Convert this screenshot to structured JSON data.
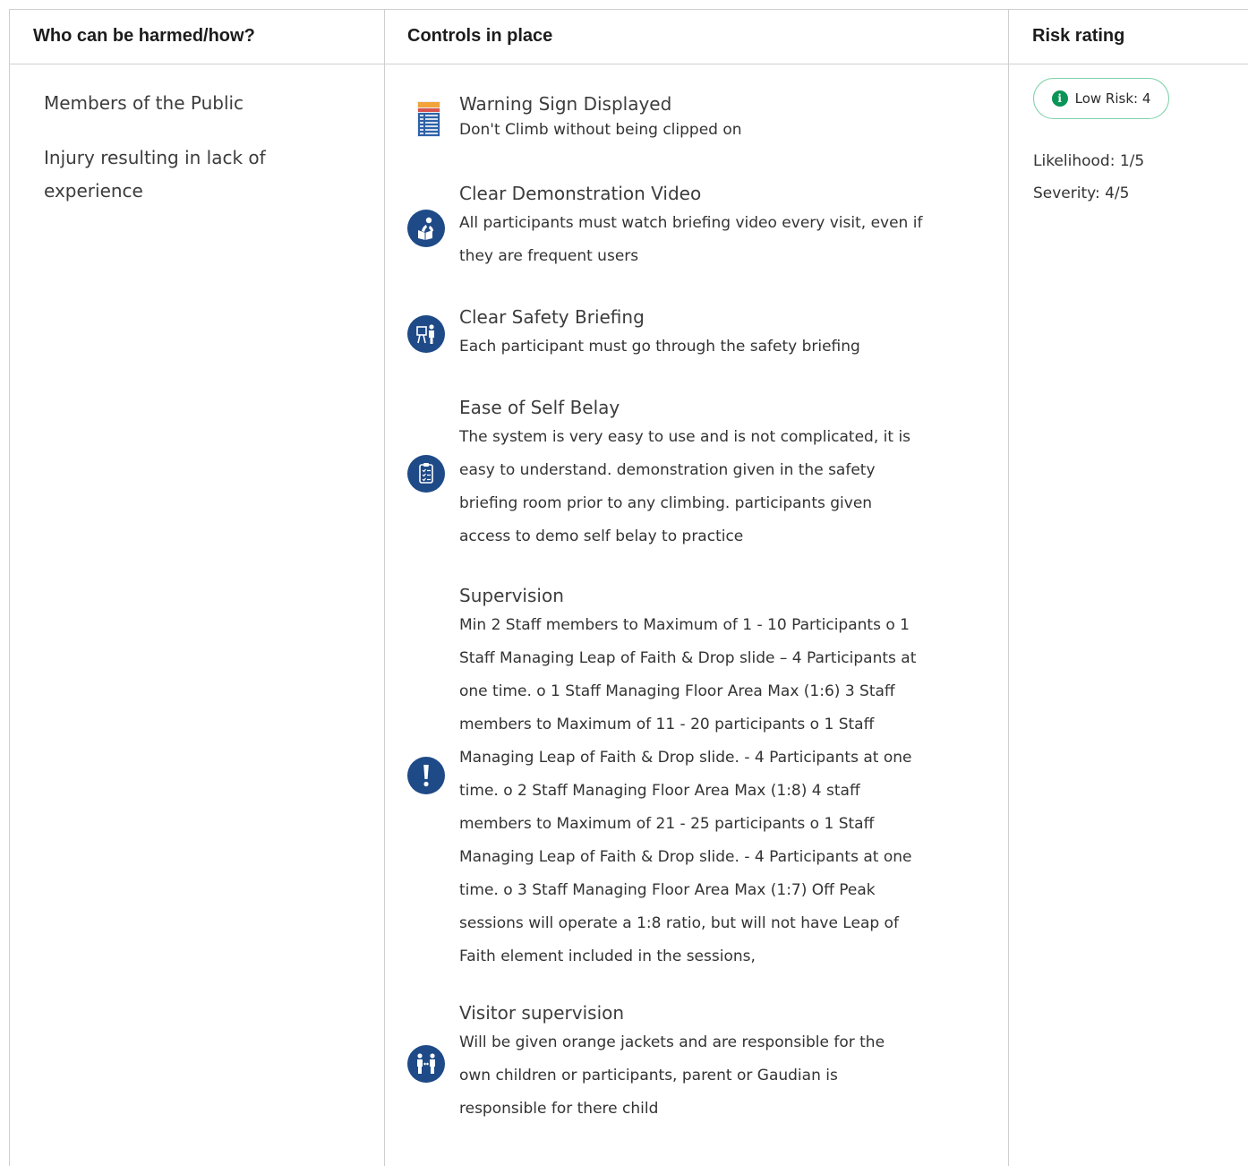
{
  "header": {
    "col_who": "Who can be harmed/how?",
    "col_controls": "Controls in place",
    "col_risk": "Risk rating"
  },
  "who": {
    "group": "Members of the Public",
    "harm_line1": "Injury resulting in lack of",
    "harm_line2": "experience"
  },
  "controls": [
    {
      "title": "Warning Sign Displayed",
      "icon": "warning-sign-image-icon",
      "lines": [
        "Don't Climb without being clipped on"
      ]
    },
    {
      "title": "Clear Demonstration Video",
      "icon": "read-instructions-icon",
      "lines": [
        "All participants must watch briefing video every visit, even if",
        "they are frequent users"
      ]
    },
    {
      "title": "Clear Safety Briefing",
      "icon": "briefing-presenter-icon",
      "lines": [
        "Each participant must go through the safety briefing"
      ]
    },
    {
      "title": "Ease of Self Belay",
      "icon": "clipboard-checklist-icon",
      "lines": [
        "The system is very easy to use and is not complicated, it is",
        "easy to understand. demonstration given in the safety",
        "briefing room prior to any climbing. participants given",
        "access to demo self belay to practice"
      ]
    },
    {
      "title": "Supervision",
      "icon": "exclamation-icon",
      "lines": [
        "Min 2 Staff members to Maximum of 1 - 10 Participants o 1",
        "Staff Managing Leap of Faith & Drop slide – 4 Participants at",
        "one time. o 1 Staff Managing Floor Area Max (1:6) 3 Staff",
        "members to Maximum of 11 - 20 participants o 1 Staff",
        "Managing Leap of Faith & Drop slide. - 4 Participants at one",
        "time. o 2 Staff Managing Floor Area Max (1:8) 4 staff",
        "members to Maximum of 21 - 25 participants o 1 Staff",
        "Managing Leap of Faith & Drop slide. - 4 Participants at one",
        "time. o 3 Staff Managing Floor Area Max (1:7) Off Peak",
        "sessions will operate a 1:8 ratio, but will not have Leap of",
        "Faith element included in the sessions,"
      ]
    },
    {
      "title": "Visitor supervision",
      "icon": "two-people-distance-icon",
      "lines": [
        "Will be given orange jackets and are responsible for the",
        "own children or participants, parent or Gaudian is",
        "responsible for there child"
      ]
    }
  ],
  "risk": {
    "badge_label": "Low Risk: 4",
    "badge_icon": "info-icon",
    "likelihood": "Likelihood: 1/5",
    "severity": "Severity: 4/5",
    "colors": {
      "badge_border": "#7fd1a8",
      "badge_dot": "#0a9456",
      "icon_blue": "#1e4a87"
    }
  }
}
